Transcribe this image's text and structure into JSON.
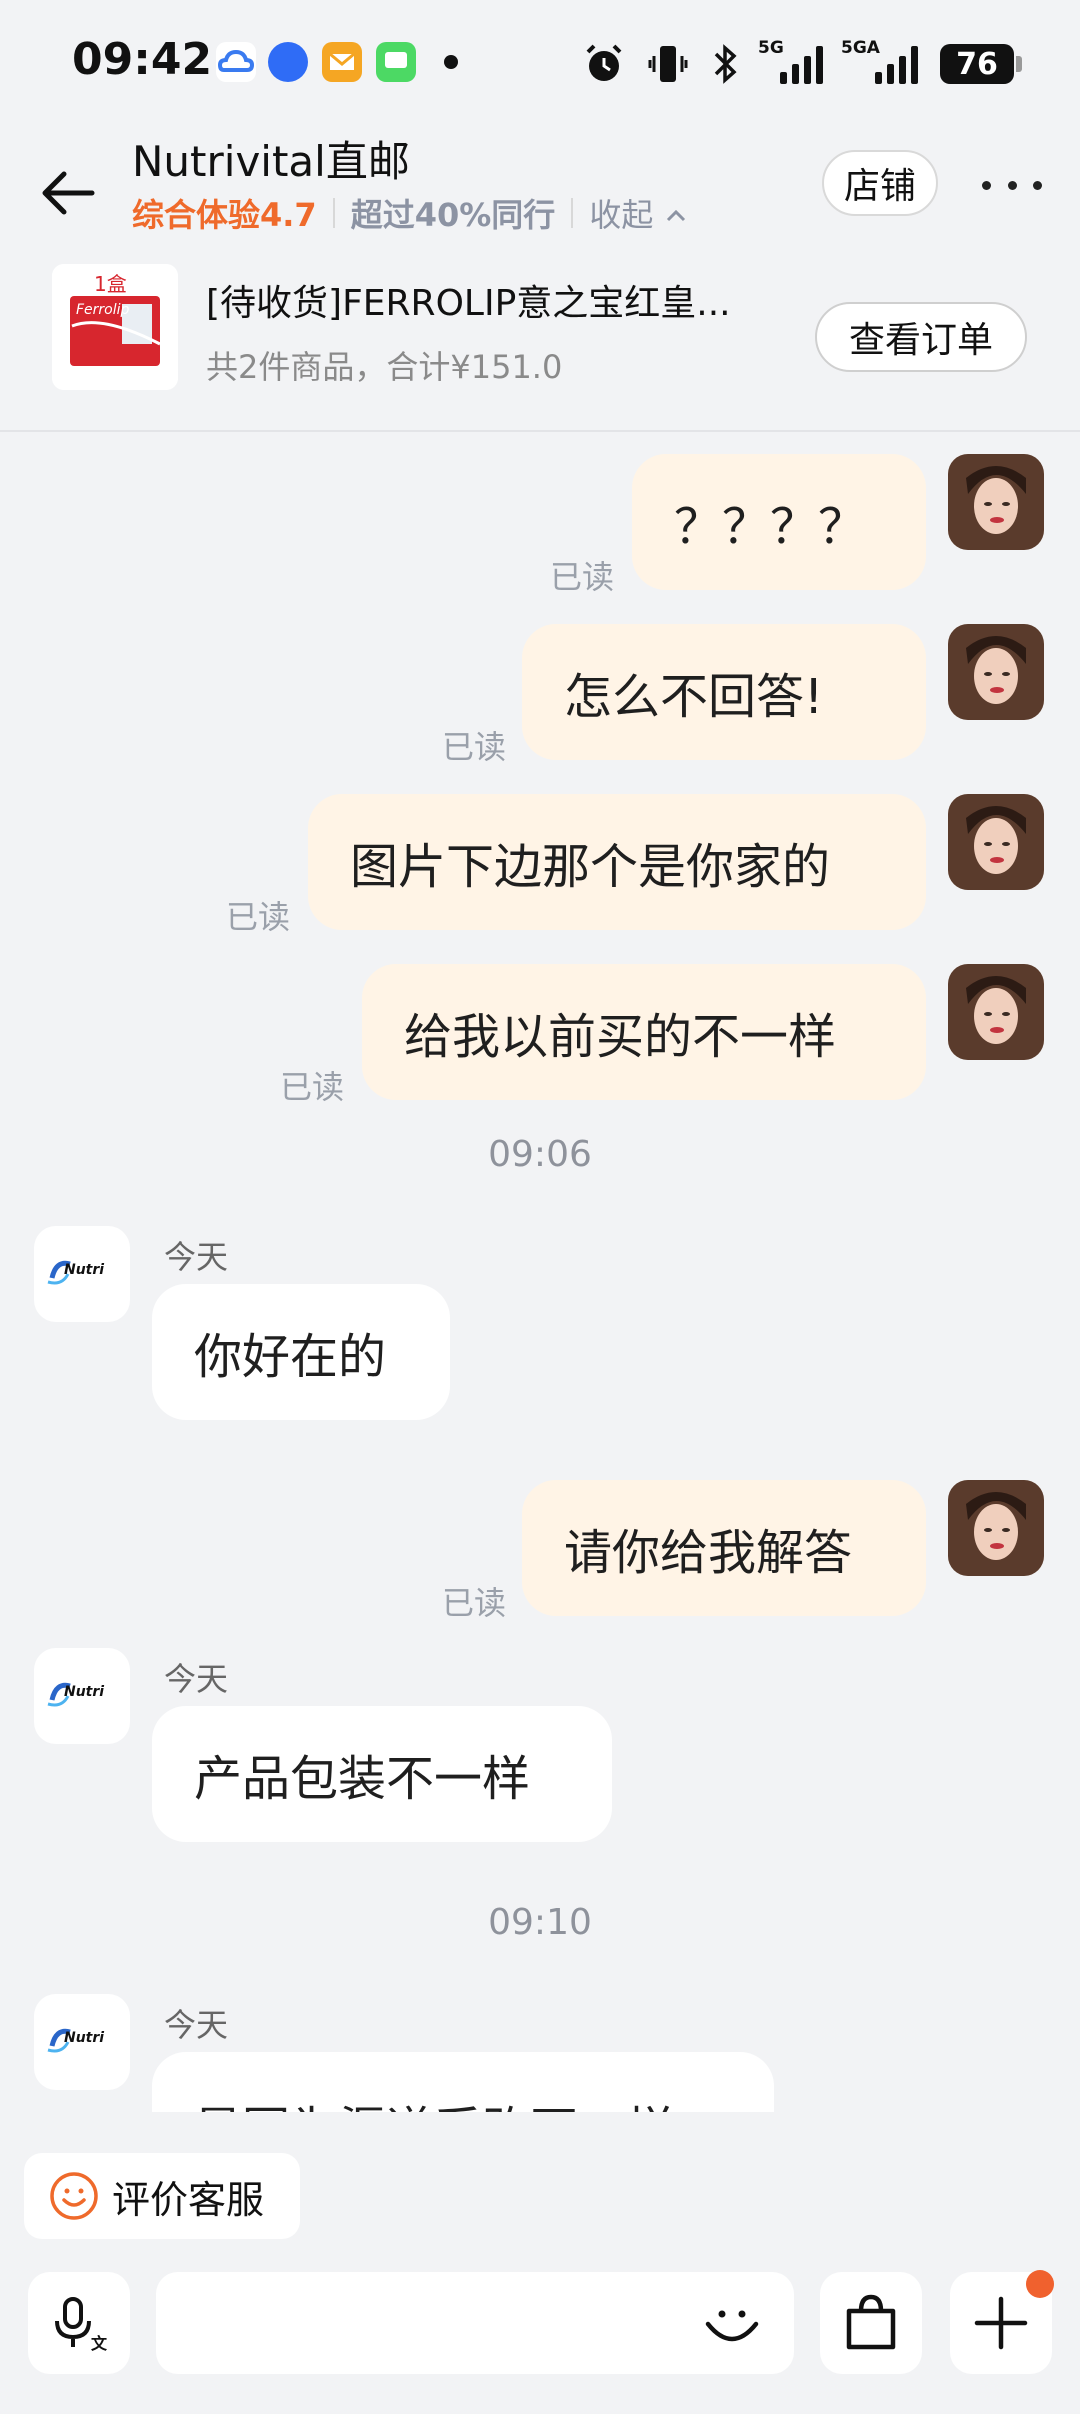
{
  "status_bar": {
    "time": "09:42",
    "battery": "76",
    "signal1_label": "5G",
    "signal2_label": "5GA"
  },
  "header": {
    "shop_name": "Nutrivital直邮",
    "score_label": "综合体验4.7",
    "rank_label": "超过40%同行",
    "collapse_label": "收起",
    "store_button": "店铺"
  },
  "order": {
    "thumb_label": "1盒",
    "thumb_brand": "Ferrolip",
    "title": "[待收货]FERROLIP意之宝红皇...",
    "subtitle": "共2件商品，合计¥151.0",
    "view_button": "查看订单"
  },
  "chat": {
    "messages": [
      {
        "text": "？？？？",
        "status": "已读"
      },
      {
        "text": "怎么不回答!",
        "status": "已读"
      },
      {
        "text": "图片下边那个是你家的",
        "status": "已读"
      },
      {
        "text": "给我以前买的不一样",
        "status": "已读"
      },
      {
        "separator": "09:06"
      },
      {
        "day": "今天",
        "text": "你好在的"
      },
      {
        "text": "请你给我解答",
        "status": "已读"
      },
      {
        "day": "今天",
        "text": "产品包装不一样"
      },
      {
        "separator": "09:10"
      },
      {
        "day": "今天",
        "text": "是因为渠道采购不一样"
      }
    ],
    "shop_avatar_text": "Nutri"
  },
  "footer": {
    "rate_button": "评价客服",
    "input_placeholder": ""
  },
  "colors": {
    "accent": "#ef6a2b",
    "outgoing_bubble": "#fff4e6",
    "incoming_bubble": "#ffffff",
    "background": "#f2f3f5",
    "badge": "#f0612e"
  }
}
